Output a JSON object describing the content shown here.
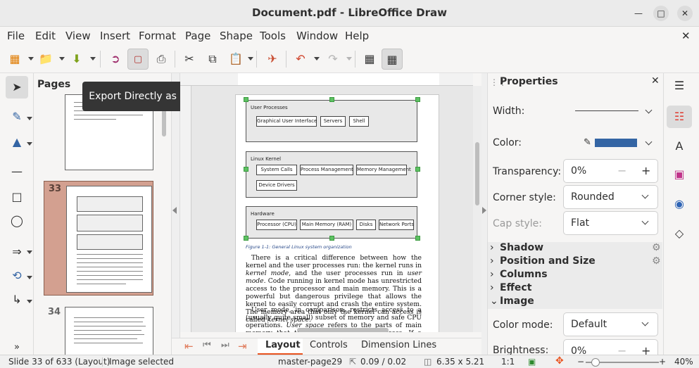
{
  "window": {
    "title": "Document.pdf - LibreOffice Draw"
  },
  "menu": [
    "File",
    "Edit",
    "View",
    "Insert",
    "Format",
    "Page",
    "Shape",
    "Tools",
    "Window",
    "Help"
  ],
  "tooltip": "Export Directly as PDF",
  "pages_panel": {
    "title": "Pages",
    "thumbs": [
      {
        "number": ""
      },
      {
        "number": "33",
        "selected": true
      },
      {
        "number": "34"
      }
    ]
  },
  "diagram": {
    "layer1": {
      "label": "User Processes",
      "boxes": [
        "Graphical User Interface",
        "Servers",
        "Shell"
      ]
    },
    "layer2": {
      "label": "Linux Kernel",
      "boxes": [
        "System Calls",
        "Process Management",
        "Memory Management",
        "Device Drivers"
      ]
    },
    "layer3": {
      "label": "Hardware",
      "boxes": [
        "Processor (CPU)",
        "Main Memory (RAM)",
        "Disks",
        "Network Ports"
      ]
    },
    "caption": "Figure 1-1: General Linux system organization"
  },
  "body": {
    "p1_a": "There is a critical difference between how the kernel and the user processes run: the kernel runs in ",
    "p1_em1": "kernel mode",
    "p1_b": ", and the user processes run in ",
    "p1_em2": "user mode",
    "p1_c": ". Code running in kernel mode has unrestricted access to the processor and main memory. This is a powerful but dangerous privilege that allows the kernel to easily corrupt and crash the entire system. The memory area that only the kernel can access is called ",
    "p1_em3": "kernel space",
    "p1_d": ".",
    "p2_a": "User mode, in comparison, restricts access to a (usually quite small) subset of memory and safe CPU operations. ",
    "p2_em1": "User space",
    "p2_b": " refers to the parts of main memory that the user processes can access. If a process makes a mistake and crashes, the consequences are limited and can be cleaned up by the kernel. This means that if your web"
  },
  "tabs": [
    "Layout",
    "Controls",
    "Dimension Lines"
  ],
  "properties": {
    "title": "Properties",
    "width_label": "Width:",
    "color_label": "Color:",
    "color_value": "#3465a4",
    "transparency_label": "Transparency:",
    "transparency_value": "0%",
    "corner_label": "Corner style:",
    "corner_value": "Rounded",
    "cap_label": "Cap style:",
    "cap_value": "Flat",
    "sections": [
      "Shadow",
      "Position and Size",
      "Columns",
      "Effect",
      "Image"
    ],
    "color_mode_label": "Color mode:",
    "color_mode_value": "Default",
    "brightness_label": "Brightness:",
    "brightness_value": "0%"
  },
  "status": {
    "slide": "Slide 33 of 633 (Layout)",
    "selection": "Image selected",
    "master": "master-page29",
    "position": "0.09 / 0.02",
    "size": "6.35 x 5.21",
    "scale": "1:1",
    "zoom": "40%"
  }
}
